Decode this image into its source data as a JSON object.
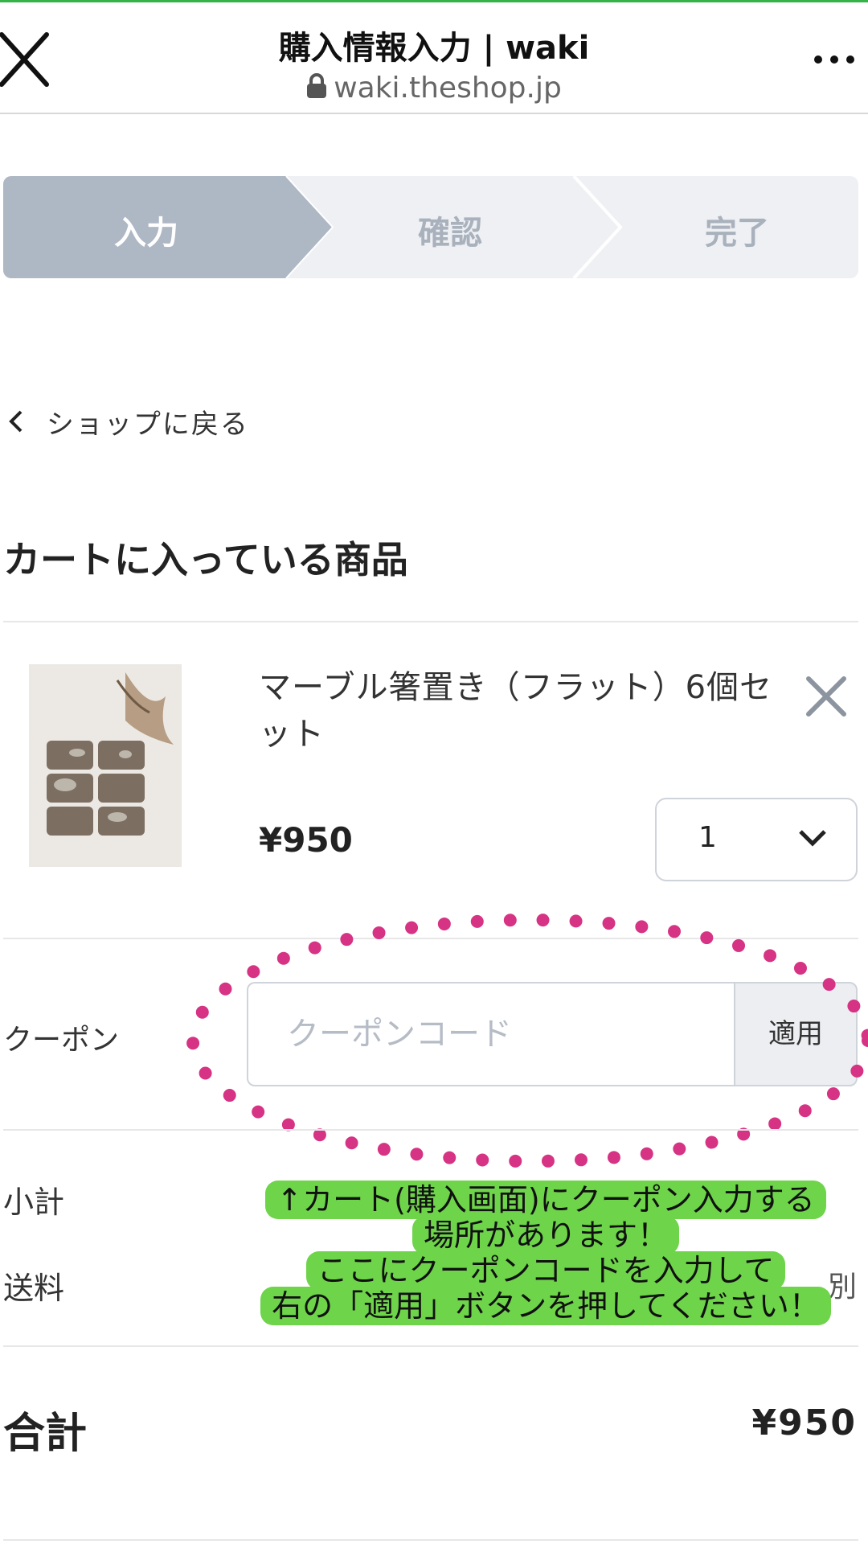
{
  "browser": {
    "title": "購入情報入力 | waki",
    "url": "waki.theshop.jp",
    "more_label": "..."
  },
  "steps": [
    {
      "label": "入力",
      "active": true
    },
    {
      "label": "確認",
      "active": false
    },
    {
      "label": "完了",
      "active": false
    }
  ],
  "back_link": {
    "chevron": "<",
    "label": "ショップに戻る"
  },
  "cart": {
    "section_title": "カートに入っている商品",
    "items": [
      {
        "name": "マーブル箸置き（フラット）6個セット",
        "price": "¥950",
        "quantity": "1"
      }
    ]
  },
  "coupon": {
    "label": "クーポン",
    "placeholder": "クーポンコード",
    "apply_label": "適用"
  },
  "summary": {
    "subtotal_label": "小計",
    "shipping_label": "送料",
    "shipping_value": "別",
    "total_label": "合計",
    "total_value": "¥950"
  },
  "annotation": {
    "lines": [
      "↑カート(購入画面)にクーポン入力する",
      "場所があります！",
      "ここにクーポンコードを入力して",
      "右の「適用」ボタンを押してください！"
    ],
    "bg_color": "#6ed44a",
    "ellipse_color": "#d63384"
  },
  "colors": {
    "step_active": "#aeb7c4",
    "step_inactive": "#eef0f4",
    "accent_line": "#35b34a"
  }
}
